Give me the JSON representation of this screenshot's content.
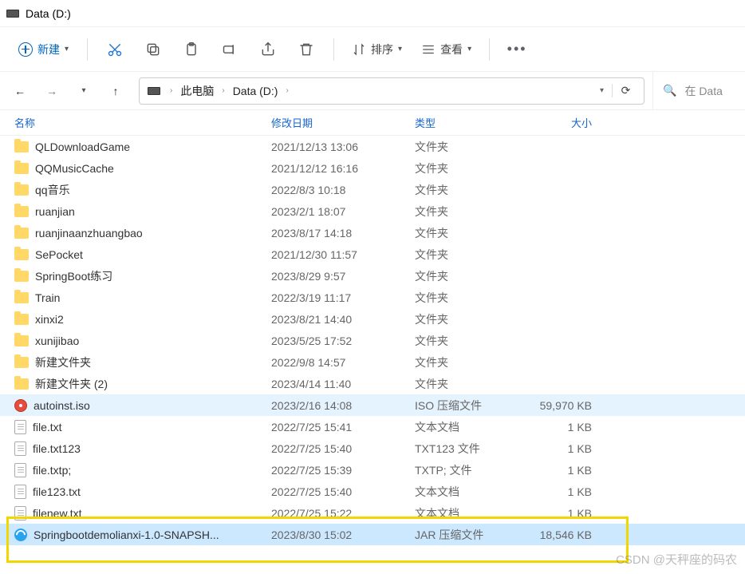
{
  "window_title": "Data (D:)",
  "toolbar": {
    "new_label": "新建",
    "sort_label": "排序",
    "view_label": "查看"
  },
  "breadcrumb": {
    "root": "此电脑",
    "current": "Data (D:)"
  },
  "search": {
    "placeholder": "在 Data"
  },
  "columns": {
    "name": "名称",
    "date": "修改日期",
    "type": "类型",
    "size": "大小"
  },
  "rows": [
    {
      "icon": "folder",
      "name": "QLDownloadGame",
      "date": "2021/12/13 13:06",
      "type": "文件夹",
      "size": ""
    },
    {
      "icon": "folder",
      "name": "QQMusicCache",
      "date": "2021/12/12 16:16",
      "type": "文件夹",
      "size": ""
    },
    {
      "icon": "folder",
      "name": "qq音乐",
      "date": "2022/8/3 10:18",
      "type": "文件夹",
      "size": ""
    },
    {
      "icon": "folder",
      "name": "ruanjian",
      "date": "2023/2/1 18:07",
      "type": "文件夹",
      "size": ""
    },
    {
      "icon": "folder",
      "name": "ruanjinaanzhuangbao",
      "date": "2023/8/17 14:18",
      "type": "文件夹",
      "size": ""
    },
    {
      "icon": "folder",
      "name": "SePocket",
      "date": "2021/12/30 11:57",
      "type": "文件夹",
      "size": ""
    },
    {
      "icon": "folder",
      "name": "SpringBoot练习",
      "date": "2023/8/29 9:57",
      "type": "文件夹",
      "size": ""
    },
    {
      "icon": "folder",
      "name": "Train",
      "date": "2022/3/19 11:17",
      "type": "文件夹",
      "size": ""
    },
    {
      "icon": "folder",
      "name": "xinxi2",
      "date": "2023/8/21 14:40",
      "type": "文件夹",
      "size": ""
    },
    {
      "icon": "folder",
      "name": "xunijibao",
      "date": "2023/5/25 17:52",
      "type": "文件夹",
      "size": ""
    },
    {
      "icon": "folder",
      "name": "新建文件夹",
      "date": "2022/9/8 14:57",
      "type": "文件夹",
      "size": ""
    },
    {
      "icon": "folder",
      "name": "新建文件夹 (2)",
      "date": "2023/4/14 11:40",
      "type": "文件夹",
      "size": ""
    },
    {
      "icon": "iso",
      "name": "autoinst.iso",
      "date": "2023/2/16 14:08",
      "type": "ISO 压缩文件",
      "size": "59,970 KB",
      "hl": true
    },
    {
      "icon": "file",
      "name": "file.txt",
      "date": "2022/7/25 15:41",
      "type": "文本文档",
      "size": "1 KB"
    },
    {
      "icon": "file",
      "name": "file.txt123",
      "date": "2022/7/25 15:40",
      "type": "TXT123 文件",
      "size": "1 KB"
    },
    {
      "icon": "file",
      "name": "file.txtp;",
      "date": "2022/7/25 15:39",
      "type": "TXTP; 文件",
      "size": "1 KB"
    },
    {
      "icon": "file",
      "name": "file123.txt",
      "date": "2022/7/25 15:40",
      "type": "文本文档",
      "size": "1 KB"
    },
    {
      "icon": "file",
      "name": "filenew.txt",
      "date": "2022/7/25 15:22",
      "type": "文本文档",
      "size": "1 KB"
    },
    {
      "icon": "jar",
      "name": "Springbootdemolianxi-1.0-SNAPSH...",
      "date": "2023/8/30 15:02",
      "type": "JAR 压缩文件",
      "size": "18,546 KB",
      "sel": true
    }
  ],
  "watermark": "CSDN @天秤座的码农"
}
